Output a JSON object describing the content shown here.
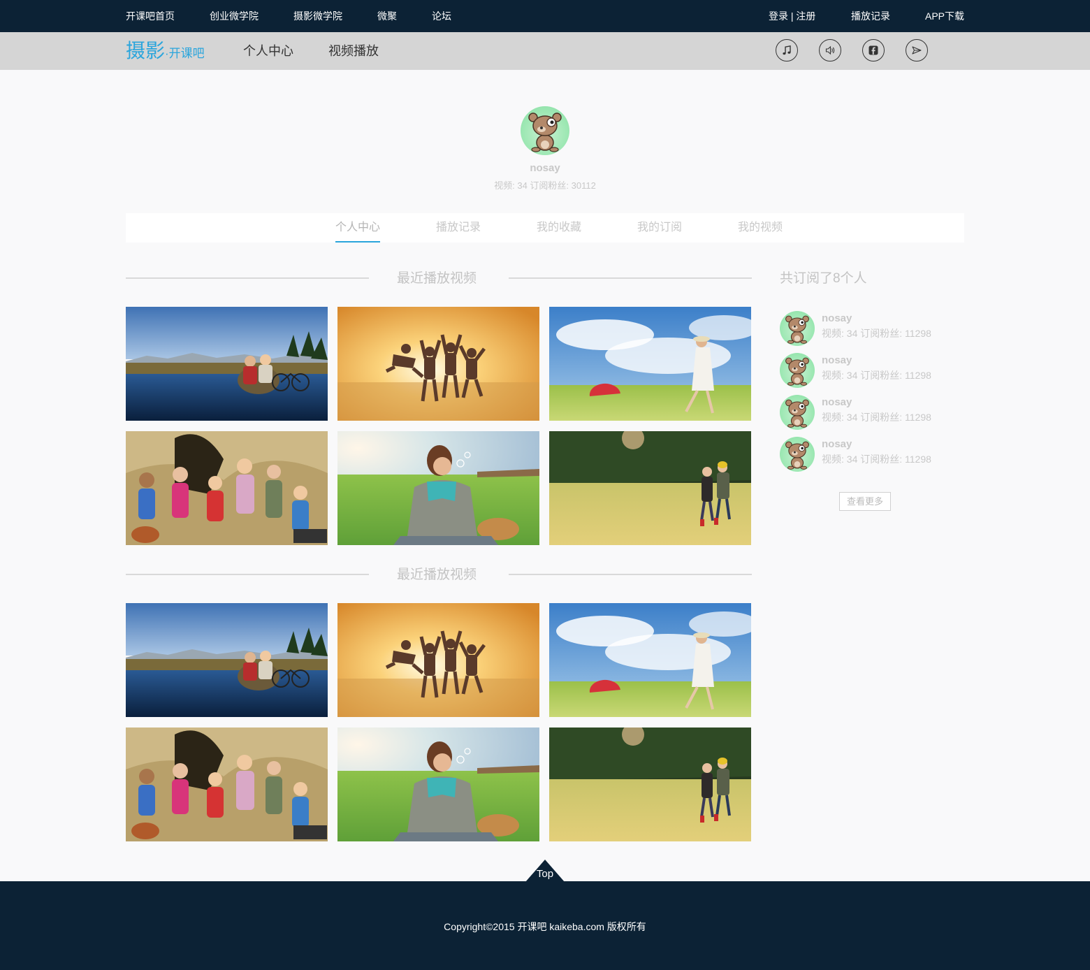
{
  "topnav": {
    "left": [
      "开课吧首页",
      "创业微学院",
      "摄影微学院",
      "微聚",
      "论坛"
    ],
    "login": "登录 | 注册",
    "history": "播放记录",
    "app": "APP下载"
  },
  "header": {
    "logo_main": "摄影",
    "logo_sub": "·开课吧",
    "nav": [
      "个人中心",
      "视频播放"
    ],
    "icons": [
      "music-icon",
      "volume-icon",
      "facebook-icon",
      "send-icon"
    ]
  },
  "profile": {
    "username": "nosay",
    "stats": "视频: 34 订阅粉丝: 30112"
  },
  "tabs": [
    "个人中心",
    "播放记录",
    "我的收藏",
    "我的订阅",
    "我的视频"
  ],
  "sections": [
    {
      "title": "最近播放视频",
      "thumbs": [
        "lake-hikers",
        "beach-jumping",
        "umbrella-meadow",
        "kids-hay-picnic",
        "bubbles-woman",
        "field-walk"
      ]
    },
    {
      "title": "最近播放视频",
      "thumbs": [
        "lake-hikers",
        "beach-jumping",
        "umbrella-meadow",
        "kids-hay-picnic",
        "bubbles-woman",
        "field-walk"
      ]
    }
  ],
  "sidebar": {
    "title": "共订阅了8个人",
    "items": [
      {
        "name": "nosay",
        "stats": "视频: 34 订阅粉丝: 11298"
      },
      {
        "name": "nosay",
        "stats": "视频: 34 订阅粉丝: 11298"
      },
      {
        "name": "nosay",
        "stats": "视频: 34 订阅粉丝: 11298"
      },
      {
        "name": "nosay",
        "stats": "视频: 34 订阅粉丝: 11298"
      }
    ],
    "more": "查看更多"
  },
  "footer": {
    "top": "Top",
    "copyright": "Copyright©2015 开课吧 kaikeba.com 版权所有"
  },
  "colors": {
    "nav_bg": "#0c2235",
    "subbar_bg": "#d5d5d5",
    "accent": "#2aa5dc"
  }
}
